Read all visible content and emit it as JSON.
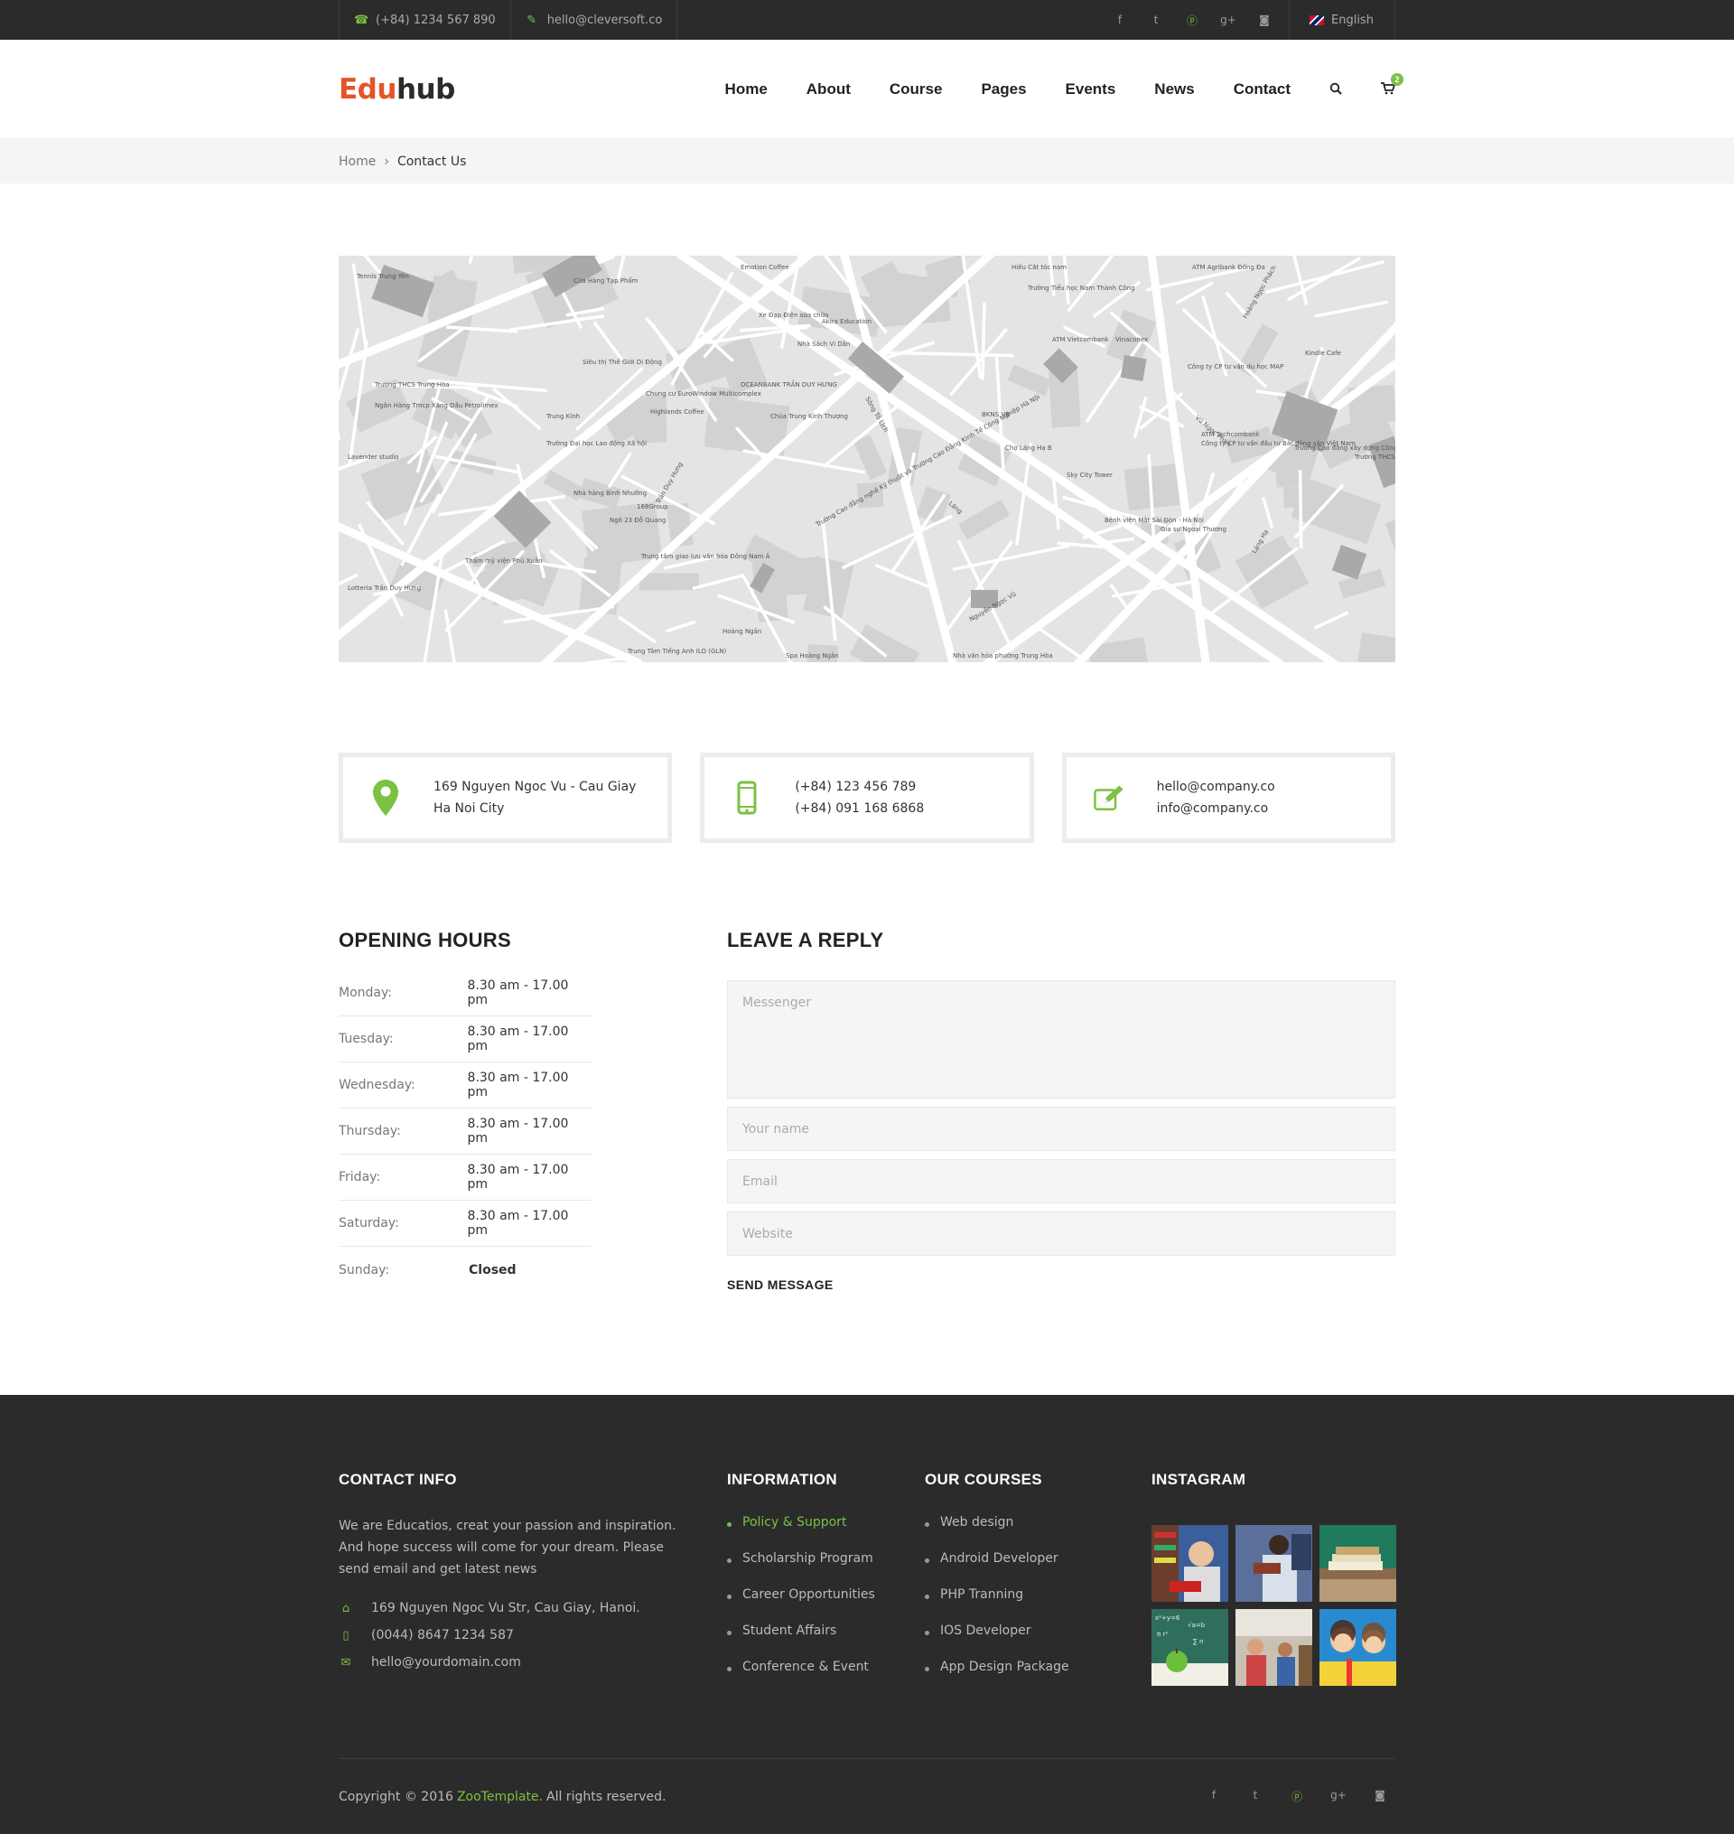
{
  "topbar": {
    "phone": "(+84) 1234 567 890",
    "email": "hello@cleversoft.co",
    "socials": [
      "facebook-icon",
      "twitter-icon",
      "pinterest-icon",
      "google-plus-icon",
      "instagram-icon"
    ],
    "language": "English"
  },
  "header": {
    "logo_part1": "Edu",
    "logo_part2": "hub",
    "nav": [
      "Home",
      "About",
      "Course",
      "Pages",
      "Events",
      "News",
      "Contact"
    ],
    "cart_count": "2"
  },
  "breadcrumb": {
    "home": "Home",
    "separator": "›",
    "current": "Contact Us"
  },
  "map": {
    "labels": [
      "Tennis Trung Yên",
      "Cửa Hàng Tạp Phẩm",
      "Siêu thị Thế Giới Di Động",
      "OCEANBANK TRẦN DUY HƯNG",
      "Chung cư EuroWindow Multicomplex",
      "Highlands Coffee",
      "Trường THCS Trung Hòa",
      "Ngân Hàng Tmcp Xăng Dầu Petrolimex",
      "Trung Kính",
      "Lavender studio",
      "Trường Đại học Lao động Xã hội",
      "Nhà hàng Bình Nhưỡng",
      "Ngõ 23 Đỗ Quang",
      "168Group",
      "Trung tâm giao lưu văn hóa Đông Nam Á",
      "Thẩm mỹ viện Phú Xuân",
      "Lotteria Trần Duy Hưng",
      "Trung Tâm Tiếng Anh ILO (GLN)",
      "Hoàng Ngân",
      "Spa Hoàng Ngân",
      "Emotion Coffee",
      "Xe Đạp Điện sửa chữa",
      "Akira Education",
      "Nhà Sách Vi Dân",
      "Chùa Trung Kính Thượng",
      "Trường Cao đẳng nghề Kỹ thuật và Trường Cao Đẳng Kinh Tế Công Nghiệp Hà Nội",
      "Nguyễn Ngọc Vũ",
      "Hiếu Cắt tóc nam",
      "Trường Tiểu học Nam Thành Công",
      "ATM Vietcombank",
      "BKNS VN",
      "Chợ Láng Hạ B",
      "Sky City Tower",
      "Bệnh viện Mắt Sài Gòn - Hà Nội",
      "Vinaconex",
      "Công ty CP tư vấn du học MAP",
      "ATM Techcombank",
      "Công ty CP tư vấn đầu tư Bất động sản Việt Nam",
      "Trường Cao đẳng xây dựng Công trình Hà Nội",
      "Trường THCS Thái Thịnh",
      "Kindle Cafe",
      "Gia sư Ngoại Thương",
      "ATM Agribank Đống Đa",
      "Láng Hạ",
      "Vũ Ngọc Phan",
      "Hoàng Ngọc Phách",
      "Trần Duy Hưng",
      "Sông Tô Lịch",
      "Láng",
      "Nhà văn hóa phường Trung Hòa"
    ]
  },
  "contact_boxes": [
    {
      "icon": "map-pin-icon",
      "lines": [
        "169 Nguyen Ngoc Vu - Cau Giay",
        "Ha Noi City"
      ]
    },
    {
      "icon": "mobile-phone-icon",
      "lines": [
        "(+84) 123 456 789",
        "(+84) 091 168 6868"
      ]
    },
    {
      "icon": "edit-icon",
      "lines": [
        "hello@company.co",
        "info@company.co"
      ]
    }
  ],
  "hours": {
    "title": "OPENING HOURS",
    "rows": [
      {
        "day": "Monday:",
        "time": "8.30 am - 17.00 pm"
      },
      {
        "day": "Tuesday:",
        "time": "8.30 am - 17.00 pm"
      },
      {
        "day": "Wednesday:",
        "time": "8.30 am - 17.00 pm"
      },
      {
        "day": "Thursday:",
        "time": "8.30 am - 17.00 pm"
      },
      {
        "day": "Friday:",
        "time": "8.30 am - 17.00 pm"
      },
      {
        "day": "Saturday:",
        "time": "8.30 am - 17.00 pm"
      },
      {
        "day": "Sunday:",
        "time": "Closed"
      }
    ]
  },
  "reply": {
    "title": "LEAVE A REPLY",
    "messenger_placeholder": "Messenger",
    "name_placeholder": "Your name",
    "email_placeholder": "Email",
    "website_placeholder": "Website",
    "send_label": "SEND MESSAGE"
  },
  "footer": {
    "contact": {
      "title": "CONTACT INFO",
      "description": "We are Educatios, creat your passion and inspiration. And hope success will come for your dream. Please send email and get latest news",
      "address": "169 Nguyen Ngoc Vu Str, Cau Giay, Hanoi.",
      "phone": "(0044) 8647 1234 587",
      "email": "hello@yourdomain.com"
    },
    "information": {
      "title": "INFORMATION",
      "items": [
        "Policy & Support",
        "Scholarship Program",
        "Career Opportunities",
        "Student Affairs",
        "Conference & Event"
      ]
    },
    "courses": {
      "title": "OUR COURSES",
      "items": [
        "Web design",
        "Android Developer",
        "PHP Tranning",
        "IOS Developer",
        "App Design Package"
      ]
    },
    "instagram": {
      "title": "INSTAGRAM"
    },
    "copyright_pre": "Copyright © 2016",
    "copyright_brand": "ZooTemplate.",
    "copyright_post": "All rights reserved."
  },
  "colors": {
    "accent": "#7cc142",
    "logo_red": "#e4542b",
    "dark": "#2b2b2b"
  }
}
